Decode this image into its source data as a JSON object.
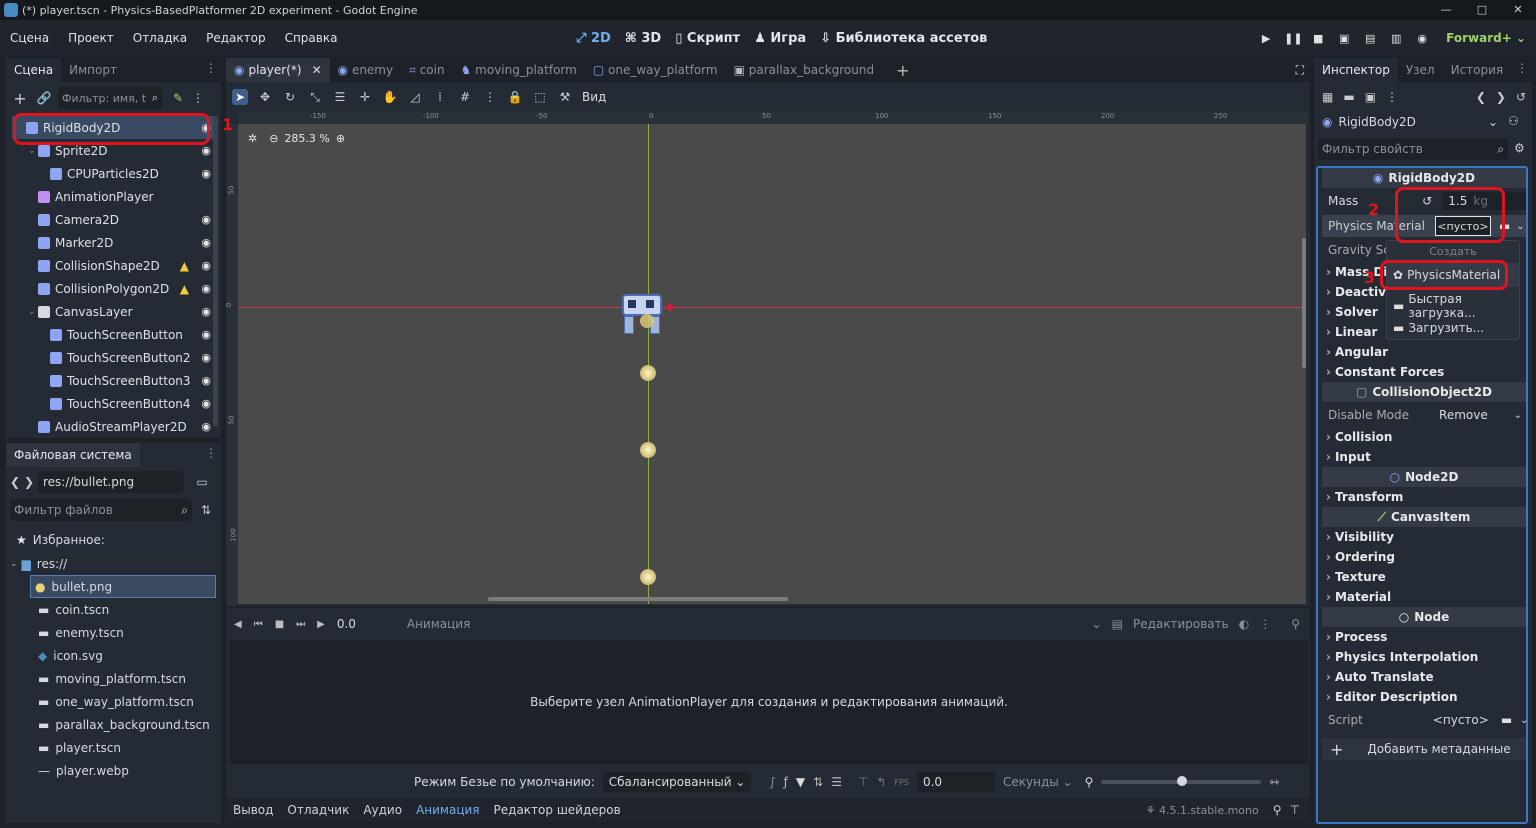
{
  "window": {
    "title": "(*) player.tscn - Physics-BasedPlatformer 2D experiment - Godot Engine",
    "controls": [
      "—",
      "□",
      "✕"
    ]
  },
  "menu": [
    "Сцена",
    "Проект",
    "Отладка",
    "Редактор",
    "Справка"
  ],
  "modes": [
    {
      "label": "2D",
      "icon": "2d-icon"
    },
    {
      "label": "3D",
      "icon": "3d-icon"
    },
    {
      "label": "Скрипт",
      "icon": "script-icon"
    },
    {
      "label": "Игра",
      "icon": "game-icon"
    },
    {
      "label": "Библиотека ассетов",
      "icon": "asset-library-icon"
    }
  ],
  "renderer": "Forward+",
  "scene_dock": {
    "tabs": [
      "Сцена",
      "Импорт"
    ],
    "filter_placeholder": "Фильтр: имя, t",
    "nodes": [
      {
        "name": "RigidBody2D",
        "depth": 0,
        "color": "#8da5f3",
        "eye": true,
        "warn": false
      },
      {
        "name": "Sprite2D",
        "depth": 1,
        "color": "#8da5f3",
        "eye": true,
        "warn": false
      },
      {
        "name": "CPUParticles2D",
        "depth": 2,
        "color": "#8da5f3",
        "eye": true,
        "warn": false
      },
      {
        "name": "AnimationPlayer",
        "depth": 1,
        "color": "#c38ef1",
        "eye": false,
        "warn": false
      },
      {
        "name": "Camera2D",
        "depth": 1,
        "color": "#8da5f3",
        "eye": true,
        "warn": false
      },
      {
        "name": "Marker2D",
        "depth": 1,
        "color": "#8da5f3",
        "eye": true,
        "warn": false
      },
      {
        "name": "CollisionShape2D",
        "depth": 1,
        "color": "#8da5f3",
        "eye": true,
        "warn": true
      },
      {
        "name": "CollisionPolygon2D",
        "depth": 1,
        "color": "#8da5f3",
        "eye": true,
        "warn": true
      },
      {
        "name": "CanvasLayer",
        "depth": 1,
        "color": "#d6dae0",
        "eye": true,
        "warn": false
      },
      {
        "name": "TouchScreenButton",
        "depth": 2,
        "color": "#8da5f3",
        "eye": true,
        "warn": false
      },
      {
        "name": "TouchScreenButton2",
        "depth": 2,
        "color": "#8da5f3",
        "eye": true,
        "warn": false
      },
      {
        "name": "TouchScreenButton3",
        "depth": 2,
        "color": "#8da5f3",
        "eye": true,
        "warn": false
      },
      {
        "name": "TouchScreenButton4",
        "depth": 2,
        "color": "#8da5f3",
        "eye": true,
        "warn": false
      },
      {
        "name": "AudioStreamPlayer2D",
        "depth": 1,
        "color": "#8da5f3",
        "eye": true,
        "warn": false
      }
    ]
  },
  "filesystem": {
    "title": "Файловая система",
    "path": "res://bullet.png",
    "filter_placeholder": "Фильтр файлов",
    "favorites": "Избранное:",
    "root": "res://",
    "files": [
      "bullet.png",
      "coin.tscn",
      "enemy.tscn",
      "icon.svg",
      "moving_platform.tscn",
      "one_way_platform.tscn",
      "parallax_background.tscn",
      "player.tscn",
      "player.webp"
    ]
  },
  "editor_tabs": [
    "player(*)",
    "enemy",
    "coin",
    "moving_platform",
    "one_way_platform",
    "parallax_background"
  ],
  "toolbar_view": "Вид",
  "zoom": "285.3 %",
  "ruler_ticks": [
    "-150",
    "-100",
    "-50",
    "0",
    "50",
    "100",
    "150",
    "200",
    "250"
  ],
  "ruler_v_ticks": [
    "50",
    "0",
    "50",
    "100"
  ],
  "animation": {
    "time": "0.0",
    "label": "Анимация",
    "edit": "Редактировать",
    "message": "Выберите узел AnimationPlayer для создания и редактирования анимаций.",
    "bezier_label": "Режим Безье по умолчанию:",
    "bezier_value": "Сбалансированный",
    "fps_value": "0.0",
    "unit": "Секунды"
  },
  "bottom_tabs": [
    "Вывод",
    "Отладчик",
    "Аудио",
    "Анимация",
    "Редактор шейдеров"
  ],
  "version": "4.5.1.stable.mono",
  "inspector": {
    "tabs": [
      "Инспектор",
      "Узел",
      "История"
    ],
    "node": "RigidBody2D",
    "filter_placeholder": "Фильтр свойств",
    "class_header": "RigidBody2D",
    "mass_label": "Mass",
    "mass_value": "1.5",
    "mass_unit": "kg",
    "physics_material_label": "Physics Material",
    "physics_material_value": "<пусто>",
    "gravity_label": "Gravity Sca",
    "sections_a": [
      "Mass Dist",
      "Deactivat",
      "Solver",
      "Linear",
      "Angular",
      "Constant Forces"
    ],
    "collision_header": "CollisionObject2D",
    "disable_mode_label": "Disable Mode",
    "disable_mode_value": "Remove",
    "sections_b": [
      "Collision",
      "Input"
    ],
    "node2d_header": "Node2D",
    "sections_c": [
      "Transform"
    ],
    "canvasitem_header": "CanvasItem",
    "sections_d": [
      "Visibility",
      "Ordering",
      "Texture",
      "Material"
    ],
    "node_header": "Node",
    "sections_e": [
      "Process",
      "Physics Interpolation",
      "Auto Translate",
      "Editor Description"
    ],
    "script_label": "Script",
    "script_value": "<пусто>",
    "add_meta": "Добавить метаданные"
  },
  "popup": {
    "header": "Создать",
    "items": [
      "PhysicsMaterial",
      "Быстрая загрузка...",
      "Загрузить..."
    ]
  },
  "annotations": [
    "1",
    "2",
    "3"
  ],
  "colors": {
    "accent": "#6eaef0",
    "annotation": "#e0141e",
    "warning": "#f1cb3c"
  }
}
